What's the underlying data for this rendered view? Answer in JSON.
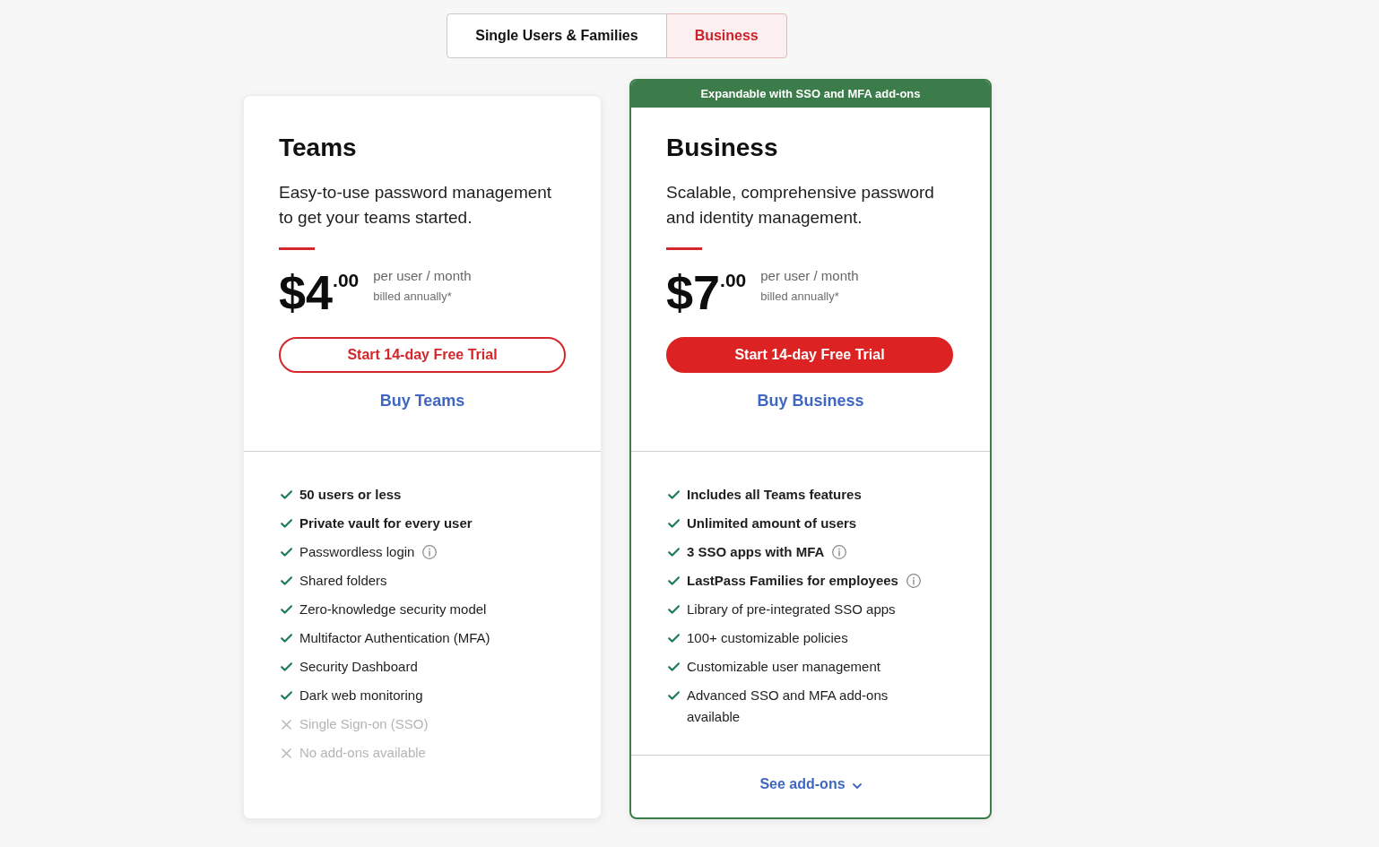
{
  "segmented_control": {
    "tabs": [
      {
        "label": "Single Users & Families",
        "selected": false
      },
      {
        "label": "Business",
        "selected": true
      }
    ]
  },
  "plans": [
    {
      "name": "Teams",
      "highlighted": false,
      "description": "Easy-to-use password management to get your teams started.",
      "price": {
        "amount": "$4",
        "cents": ".00",
        "period": "per user / month",
        "billing": "billed annually*"
      },
      "trial_button": {
        "label": "Start 14-day Free Trial",
        "kind": "outline"
      },
      "buy_link": "Buy Teams",
      "features": [
        {
          "text": "50 users or less",
          "bold": true,
          "included": true,
          "info": false
        },
        {
          "text": "Private vault for every user",
          "bold": true,
          "included": true,
          "info": false
        },
        {
          "text": "Passwordless login",
          "bold": false,
          "included": true,
          "info": true
        },
        {
          "text": "Shared folders",
          "bold": false,
          "included": true,
          "info": false
        },
        {
          "text": "Zero-knowledge security model",
          "bold": false,
          "included": true,
          "info": false
        },
        {
          "text": "Multifactor Authentication (MFA)",
          "bold": false,
          "included": true,
          "info": false
        },
        {
          "text": "Security Dashboard",
          "bold": false,
          "included": true,
          "info": false
        },
        {
          "text": "Dark web monitoring",
          "bold": false,
          "included": true,
          "info": false
        },
        {
          "text": "Single Sign-on (SSO)",
          "bold": false,
          "included": false,
          "info": false
        },
        {
          "text": "No add-ons available",
          "bold": false,
          "included": false,
          "info": false
        }
      ]
    },
    {
      "banner": "Expandable with SSO and MFA add-ons",
      "name": "Business",
      "highlighted": true,
      "description": "Scalable, comprehensive password and identity management.",
      "price": {
        "amount": "$7",
        "cents": ".00",
        "period": "per user / month",
        "billing": "billed annually*"
      },
      "trial_button": {
        "label": "Start 14-day Free Trial",
        "kind": "filled"
      },
      "buy_link": "Buy Business",
      "features": [
        {
          "text": "Includes all Teams features",
          "bold": true,
          "included": true,
          "info": false
        },
        {
          "text": "Unlimited amount of users",
          "bold": true,
          "included": true,
          "info": false
        },
        {
          "text": "3 SSO apps with MFA",
          "bold": true,
          "included": true,
          "info": true
        },
        {
          "text": "LastPass Families for employees",
          "bold": true,
          "included": true,
          "info": true
        },
        {
          "text": "Library of pre-integrated SSO apps",
          "bold": false,
          "included": true,
          "info": false
        },
        {
          "text": "100+ customizable policies",
          "bold": false,
          "included": true,
          "info": false
        },
        {
          "text": "Customizable user management",
          "bold": false,
          "included": true,
          "info": false
        },
        {
          "text": "Advanced SSO and MFA add-ons available",
          "bold": false,
          "included": true,
          "info": false
        }
      ],
      "footer_link": "See add-ons"
    }
  ]
}
